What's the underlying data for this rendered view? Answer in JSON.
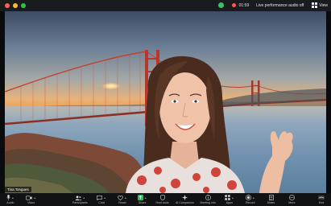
{
  "window": {
    "status_text": "Live performance audio off",
    "timer": "01:59",
    "view_label": "View"
  },
  "video": {
    "participant_name": "Tina Tongues"
  },
  "toolbar": {
    "items": [
      {
        "label": "Audio",
        "icon": "microphone-icon"
      },
      {
        "label": "Video",
        "icon": "video-camera-icon"
      },
      {
        "label": "Participants",
        "icon": "participants-icon"
      },
      {
        "label": "Chat",
        "icon": "chat-icon"
      },
      {
        "label": "React",
        "icon": "heart-icon"
      },
      {
        "label": "Share",
        "icon": "share-screen-icon"
      },
      {
        "label": "Host tools",
        "icon": "shield-icon"
      },
      {
        "label": "AI Companion",
        "icon": "sparkle-icon"
      },
      {
        "label": "Meeting info",
        "icon": "info-icon"
      },
      {
        "label": "Apps",
        "icon": "apps-icon"
      },
      {
        "label": "Record",
        "icon": "record-icon"
      },
      {
        "label": "Notes",
        "icon": "notes-icon"
      },
      {
        "label": "More",
        "icon": "more-icon"
      },
      {
        "label": "End",
        "icon": "end-call-icon"
      }
    ]
  },
  "colors": {
    "toolbar_bg": "#111214",
    "share_green": "#2fbf62",
    "record_red": "#ff5a52",
    "shield_green": "#3cc16a"
  }
}
